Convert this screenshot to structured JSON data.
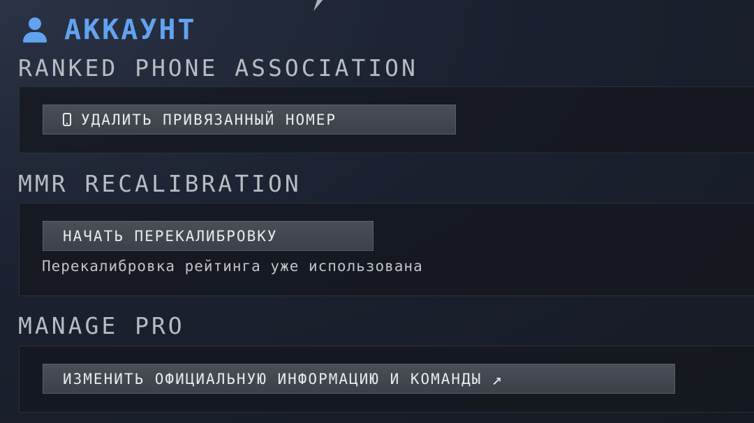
{
  "header": {
    "title": "АККАУНТ",
    "icon": "user-icon",
    "accent_color": "#62a3f0"
  },
  "sections": [
    {
      "title": "RANKED PHONE ASSOCIATION",
      "button_label": "УДАЛИТЬ ПРИВЯЗАННЫЙ НОМЕР",
      "button_icon": "phone-icon"
    },
    {
      "title": "MMR RECALIBRATION",
      "button_label": "НАЧАТЬ ПЕРЕКАЛИБРОВКУ",
      "note": "Перекалибровка рейтинга уже использована"
    },
    {
      "title": "MANAGE PRO",
      "button_label": "ИЗМЕНИТЬ ОФИЦИАЛЬНУЮ ИНФОРМАЦИЮ И КОМАНДЫ",
      "button_icon": "external-link-icon",
      "arrow_glyph": "↗"
    }
  ]
}
